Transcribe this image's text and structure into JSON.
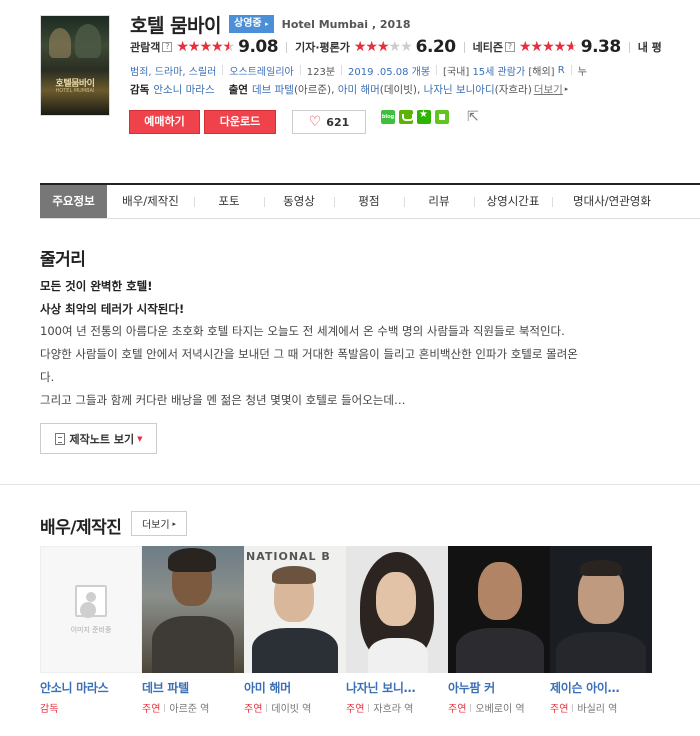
{
  "movie": {
    "title": "호텔 뭄바이",
    "status_badge": "상영중",
    "original_title": "Hotel Mumbai , 2018"
  },
  "poster": {
    "title_text": "호텔뭄바이",
    "sub_text": "HOTEL MUMBAI"
  },
  "ratings": [
    {
      "label": "관람객",
      "score": "9.08",
      "fill": 0.908
    },
    {
      "label": "기자·평론가",
      "score": "6.20",
      "fill": 0.62
    },
    {
      "label": "네티즌",
      "score": "9.38",
      "fill": 0.938
    },
    {
      "label": "내 평"
    }
  ],
  "info": {
    "genres": "범죄, 드라마, 스릴러",
    "country": "오스트레일리아",
    "runtime": "123분",
    "release": "2019 .05.08 개봉",
    "grade_domestic_label": "[국내]",
    "grade_domestic": "15세 관람가",
    "grade_overseas_label": "[해외]",
    "grade_overseas": "R",
    "cumulative": "누"
  },
  "credits": {
    "director_label": "감독",
    "director": "안소니 마라스",
    "cast_label": "출연",
    "cast1": "데브 파텔",
    "cast1_role": "(아르준),",
    "cast2": "아미 해머",
    "cast2_role": "(데이빗),",
    "cast3": "나자닌 보니아디",
    "cast3_role": "(자흐라)",
    "more": "더보기"
  },
  "actions": {
    "reserve": "예매하기",
    "download": "다운로드",
    "likes": "621"
  },
  "share_icons": [
    "blog-icon",
    "band-icon",
    "bookmark-star-icon",
    "line-icon",
    "share-export-icon"
  ],
  "share_blog_text": "blog",
  "tabs": [
    "주요정보",
    "배우/제작진",
    "포토",
    "동영상",
    "평점",
    "리뷰",
    "상영시간표",
    "명대사/연관영화"
  ],
  "synopsis": {
    "heading": "줄거리",
    "tagline1": "모든 것이 완벽한 호텔!",
    "tagline2": "사상 최악의 테러가 시작된다!",
    "line1": "100여 년 전통의 아름다운 초호화 호텔 타지는 오늘도 전 세계에서 온 수백 명의 사람들과 직원들로 북적인다.",
    "line2": " 다양한 사람들이 호텔 안에서 저녁시간을 보내던 그 때 거대한 폭발음이 들리고 혼비백산한 인파가 호텔로 몰려온",
    "line3": "다.",
    "line4": " 그리고 그들과 함께 커다란 배낭을 멘 젊은 청년 몇몇이 호텔로 들어오는데…",
    "note_button": "제작노트 보기"
  },
  "cast_section": {
    "heading": "배우/제작진",
    "more_button": "더보기",
    "no_image_text": "이미지 준비중",
    "people": [
      {
        "name": "안소니 마라스",
        "role_type": "감독",
        "role": ""
      },
      {
        "name": "데브 파텔",
        "role_type": "주연",
        "role": "아르준 역"
      },
      {
        "name": "아미 해머",
        "role_type": "주연",
        "role": "데이빗 역"
      },
      {
        "name": "나자닌 보니…",
        "role_type": "주연",
        "role": "자흐라 역"
      },
      {
        "name": "아누팜 커",
        "role_type": "주연",
        "role": "오베로이 역"
      },
      {
        "name": "제이슨 아이…",
        "role_type": "주연",
        "role": "바실리 역"
      }
    ],
    "photo_backdrop_text": "NATIONAL B"
  },
  "colors": {
    "accent_red": "#f0424a",
    "star_red": "#e8303c",
    "link_blue": "#3b6fb6",
    "badge_blue": "#4a8fd8",
    "tab_active_bg": "#777777"
  }
}
